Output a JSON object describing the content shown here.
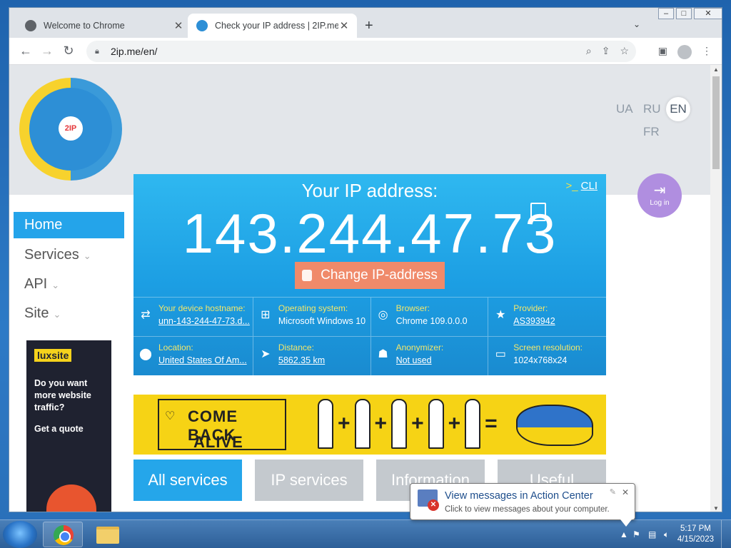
{
  "browser": {
    "tabs": [
      {
        "title": "Welcome to Chrome",
        "close": "✕"
      },
      {
        "title": "Check your IP address | 2IP.me",
        "close": "✕"
      }
    ],
    "new_tab": "+",
    "tab_menu": "⌄",
    "url": "2ip.me/en/",
    "window_controls": [
      "–",
      "□",
      "✕"
    ]
  },
  "site": {
    "logo_text": "2IP",
    "languages": {
      "ua": "UA",
      "ru": "RU",
      "en": "EN",
      "fr": "FR",
      "selected": "EN"
    },
    "login": "Log in",
    "nav": [
      {
        "label": "Home",
        "active": true
      },
      {
        "label": "Services",
        "chevron": "⌄"
      },
      {
        "label": "API",
        "chevron": "⌄"
      },
      {
        "label": "Site",
        "chevron": "⌄"
      }
    ],
    "ad": {
      "brand": "luxsite",
      "text": "Do you want more website traffic?",
      "cta": "Get a quote"
    },
    "ip": {
      "label": "Your IP address:",
      "value": "143.244.47.73",
      "cli": "CLI",
      "cli_prompt": ">_",
      "change_button": "Change IP-address"
    },
    "info": [
      {
        "key": "Your device hostname:",
        "value": "unn-143-244-47-73.d...",
        "icon": "refresh-icon",
        "glyph": "⇄",
        "underline": true
      },
      {
        "key": "Operating system:",
        "value": "Microsoft Windows 10",
        "icon": "windows-icon",
        "glyph": "⊞",
        "underline": false
      },
      {
        "key": "Browser:",
        "value": "Chrome 109.0.0.0",
        "icon": "chrome-icon",
        "glyph": "◎",
        "underline": false
      },
      {
        "key": "Provider:",
        "value": "AS393942",
        "icon": "star-icon",
        "glyph": "★",
        "underline": true
      },
      {
        "key": "Location:",
        "value": "United States Of Am...",
        "icon": "location-pin-icon",
        "glyph": "⬤",
        "underline": true
      },
      {
        "key": "Distance:",
        "value": "5862.35 km",
        "icon": "navigation-arrow-icon",
        "glyph": "➤",
        "underline": true
      },
      {
        "key": "Anonymizer:",
        "value": "Not used",
        "icon": "spy-icon",
        "glyph": "☗",
        "underline": true
      },
      {
        "key": "Screen resolution:",
        "value": "1024x768x24",
        "icon": "laptop-icon",
        "glyph": "▭",
        "underline": false
      }
    ],
    "banner": {
      "line1": "COME BACK",
      "line2": "ALIVE",
      "equals": "=",
      "plus": "+"
    },
    "service_tabs": [
      {
        "label": "All services",
        "active": true
      },
      {
        "label": "IP services"
      },
      {
        "label": "Information"
      },
      {
        "label": "Useful"
      }
    ]
  },
  "balloon": {
    "title": "View messages in Action Center",
    "subtitle": "Click to view messages about your computer.",
    "close": "✕"
  },
  "taskbar": {
    "time": "5:17 PM",
    "date": "4/15/2023"
  },
  "colors": {
    "accent": "#24a4ea",
    "change_button": "#f08a6a",
    "banner": "#f6d315",
    "login": "#b08ee0"
  }
}
